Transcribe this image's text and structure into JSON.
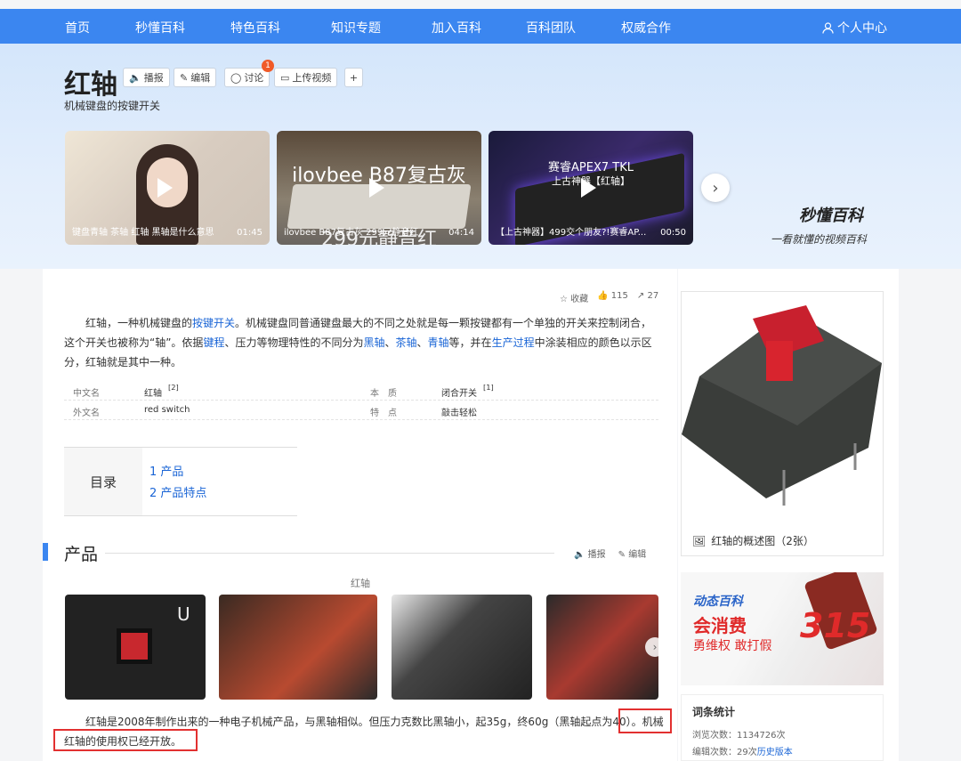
{
  "nav": {
    "items": [
      "首页",
      "秒懂百科",
      "特色百科",
      "知识专题",
      "加入百科",
      "百科团队",
      "权威合作"
    ],
    "user": "个人中心"
  },
  "entry": {
    "title": "红轴",
    "subtitle": "机械键盘的按键开关",
    "tools": [
      "播报",
      "编辑",
      "讨论",
      "上传视频"
    ],
    "discuss_badge": "1"
  },
  "videos": [
    {
      "caption": "键盘青轴 茶轴 红轴 黑轴是什么意思",
      "duration": "01:45",
      "overlay": ""
    },
    {
      "caption": "ilovbee B87复古灰 299元静音红",
      "duration": "04:14",
      "overlay": "ilovbee B87复古灰",
      "overlay2": "299元静音红"
    },
    {
      "caption": "【上古神器】499交个朋友?!赛睿AP...",
      "duration": "00:50",
      "overlay": "赛睿APEX7 TKL",
      "overlay2": "上古神器【红轴】"
    }
  ],
  "brand": {
    "name": "秒懂百科",
    "slogan": "一看就懂的视频百科"
  },
  "actions": {
    "collect": "收藏",
    "likes": "115",
    "shares": "27"
  },
  "intro": {
    "p1": "红轴，一种机械键盘的",
    "l1": "按键开关",
    "p2": "。机械键盘同普通键盘最大的不同之处就是每一颗按键都有一个单独的开关来控制闭合，这个开关也被称为“轴”。依据",
    "l2": "键程",
    "p3": "、压力等物理特性的不同分为",
    "l3": "黑轴",
    "p4": "、",
    "l4": "茶轴",
    "p5": "、",
    "l5": "青轴",
    "p6": "等，并在",
    "l6": "生产过程",
    "p7": "中涂装相应的颜色以示区分，红轴就是其中一种。"
  },
  "basic_info": [
    {
      "k1": "中文名",
      "v1": "红轴",
      "r1": "[2]",
      "k2": "本　质",
      "v2": "闭合开关",
      "r2": "[1]"
    },
    {
      "k1": "外文名",
      "v1": "red switch",
      "r1": "",
      "k2": "特　点",
      "v2": "敲击轻松",
      "r2": ""
    }
  ],
  "toc": {
    "label": "目录",
    "items": [
      "1  产品",
      "2  产品特点"
    ]
  },
  "section": {
    "title": "产品",
    "tools": [
      "播报",
      "编辑"
    ],
    "gallery_caption": "红轴"
  },
  "body": {
    "text1": "红轴是2008年制作出来的一种电子机械产品，与黑轴相似。但压力克数比黑轴小，起35g，终60g（黑轴起点为40）",
    "text2": "。机械",
    "text3": "红轴的使用权已经开放。"
  },
  "sidebar": {
    "pic_caption": "红轴的概述图（2张）",
    "ad": {
      "title": "动态百科",
      "line1": "会消费",
      "line2": "勇维权 敢打假",
      "num": "315"
    },
    "stats": {
      "title": "词条统计",
      "views_label": "浏览次数：",
      "views": "1134726次",
      "edits_label": "编辑次数：",
      "edits": "29次",
      "history": "历史版本"
    }
  }
}
